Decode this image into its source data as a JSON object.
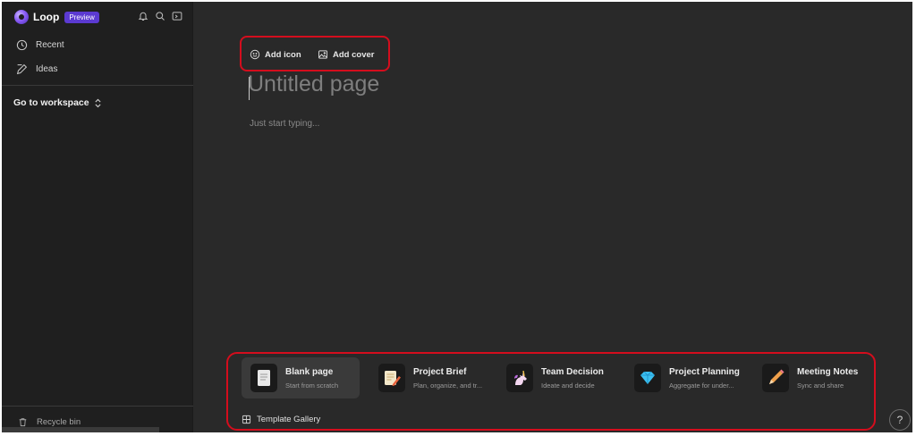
{
  "app": {
    "name": "Loop",
    "badge": "Preview"
  },
  "sidebar": {
    "nav": [
      {
        "label": "Recent",
        "icon": "clock-icon"
      },
      {
        "label": "Ideas",
        "icon": "pen-icon"
      }
    ],
    "workspace": "Go to workspace",
    "recycle_bin": "Recycle bin"
  },
  "page": {
    "actions": {
      "add_icon": "Add icon",
      "add_cover": "Add cover"
    },
    "title": "Untitled page",
    "placeholder": "Just start typing..."
  },
  "templates": [
    {
      "title": "Blank page",
      "subtitle": "Start from scratch",
      "icon": "blank-page-icon"
    },
    {
      "title": "Project Brief",
      "subtitle": "Plan, organize, and tr...",
      "icon": "notepad-pencil-icon"
    },
    {
      "title": "Team Decision",
      "subtitle": "Ideate and decide",
      "icon": "unicorn-icon"
    },
    {
      "title": "Project Planning",
      "subtitle": "Aggregate for under...",
      "icon": "diamond-icon"
    },
    {
      "title": "Meeting Notes",
      "subtitle": "Sync and share",
      "icon": "pencil-icon"
    }
  ],
  "template_gallery": "Template Gallery",
  "help_label": "?",
  "colors": {
    "accent": "#5b3ad1",
    "highlight_border": "#d40d1d",
    "canvas": "#292929",
    "sidebar": "#1f1f1f"
  }
}
